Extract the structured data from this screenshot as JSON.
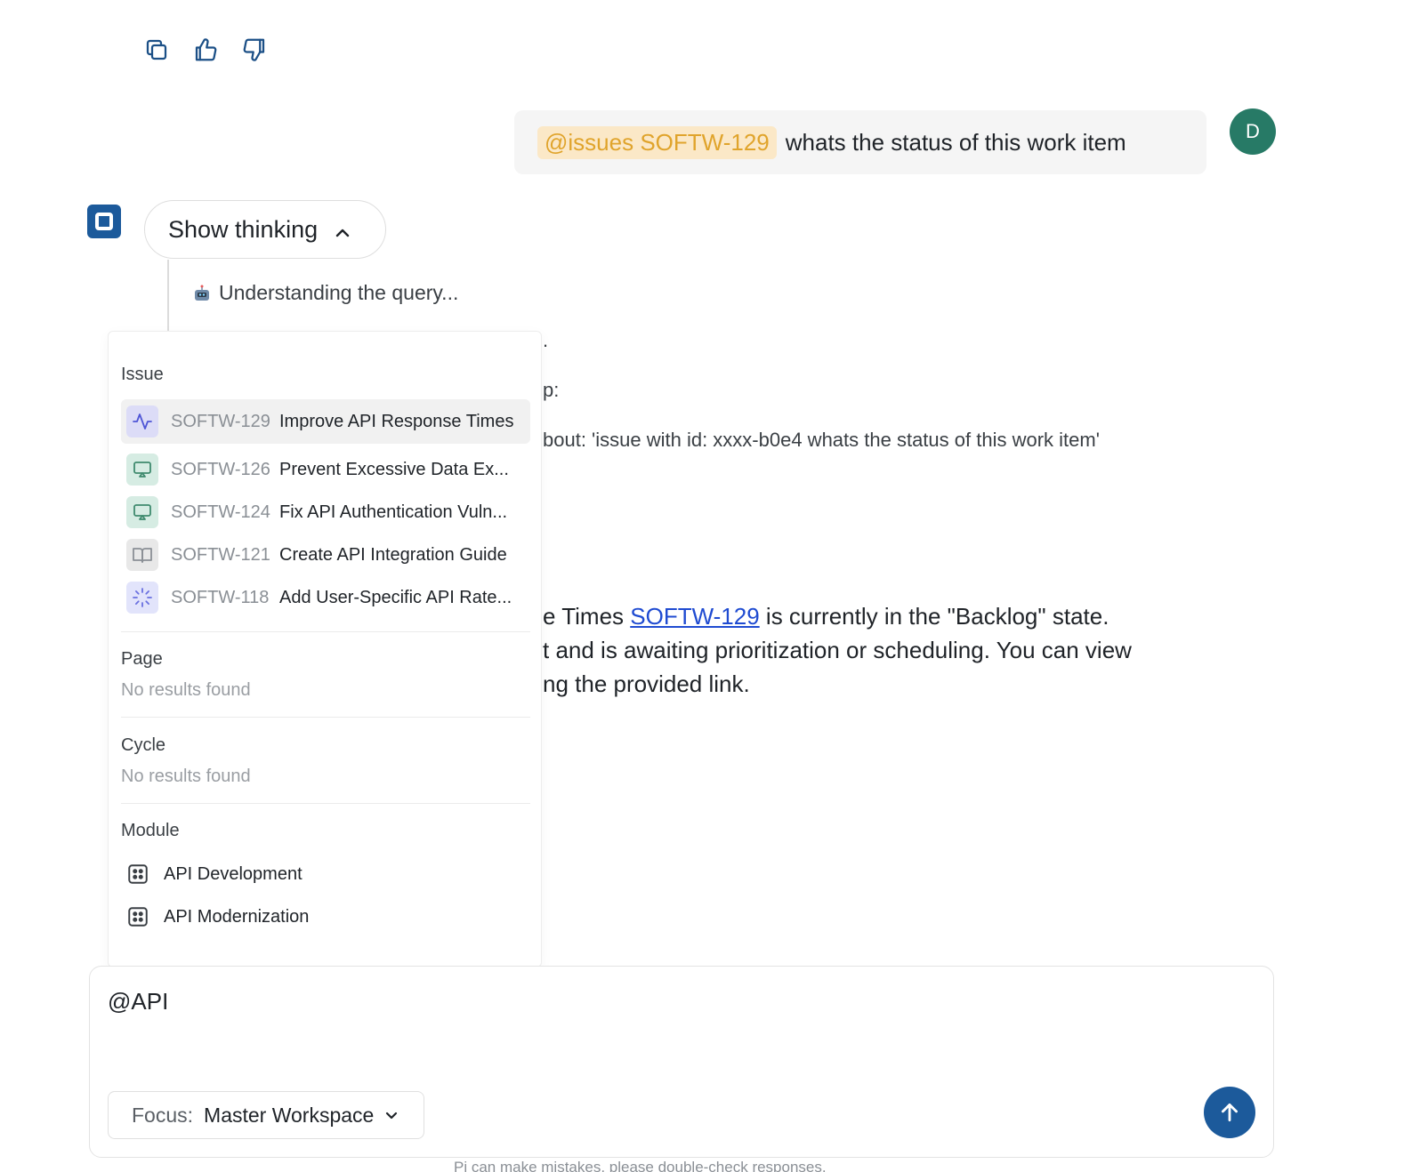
{
  "feedback": {
    "icons": [
      "copy-icon",
      "thumbs-up-icon",
      "thumbs-down-icon"
    ]
  },
  "user_message": {
    "mention": "@issues SOFTW-129",
    "text": "whats the status of this work item",
    "avatar_initial": "D"
  },
  "assistant": {
    "show_thinking_label": "Show thinking",
    "thinking_step": "Understanding the query...",
    "partial_lines": [
      ".",
      "p:",
      "bout: 'issue with id: xxxx-b0e4 whats the status of this work item'"
    ],
    "answer": {
      "line1_prefix": "e Times ",
      "line1_link": "SOFTW-129",
      "line1_suffix": " is currently in the \"Backlog\" state.",
      "line2": "t and is awaiting prioritization or scheduling. You can view",
      "line3": "ng the provided link."
    }
  },
  "dropdown": {
    "issue_section": {
      "title": "Issue",
      "items": [
        {
          "id": "SOFTW-129",
          "title": "Improve API Response Times",
          "icon": "activity-icon"
        },
        {
          "id": "SOFTW-126",
          "title": "Prevent Excessive Data Ex...",
          "icon": "airplay-icon"
        },
        {
          "id": "SOFTW-124",
          "title": "Fix API Authentication Vuln...",
          "icon": "airplay-icon"
        },
        {
          "id": "SOFTW-121",
          "title": "Create API Integration Guide",
          "icon": "book-open-icon"
        },
        {
          "id": "SOFTW-118",
          "title": "Add User-Specific API Rate...",
          "icon": "loader-icon"
        }
      ]
    },
    "page_section": {
      "title": "Page",
      "empty": "No results found"
    },
    "cycle_section": {
      "title": "Cycle",
      "empty": "No results found"
    },
    "module_section": {
      "title": "Module",
      "items": [
        {
          "label": "API Development",
          "icon": "module-icon"
        },
        {
          "label": "API Modernization",
          "icon": "module-icon"
        }
      ]
    }
  },
  "composer": {
    "input_value": "@API",
    "focus_label": "Focus:",
    "focus_value": "Master Workspace"
  },
  "disclaimer": "Pi can make mistakes, please double-check responses.",
  "colors": {
    "brand": "#1c5a9b",
    "avatar": "#277a66",
    "mention_bg": "#fbe8c7",
    "mention_text": "#e0a42c",
    "link": "#1f4bd1"
  }
}
